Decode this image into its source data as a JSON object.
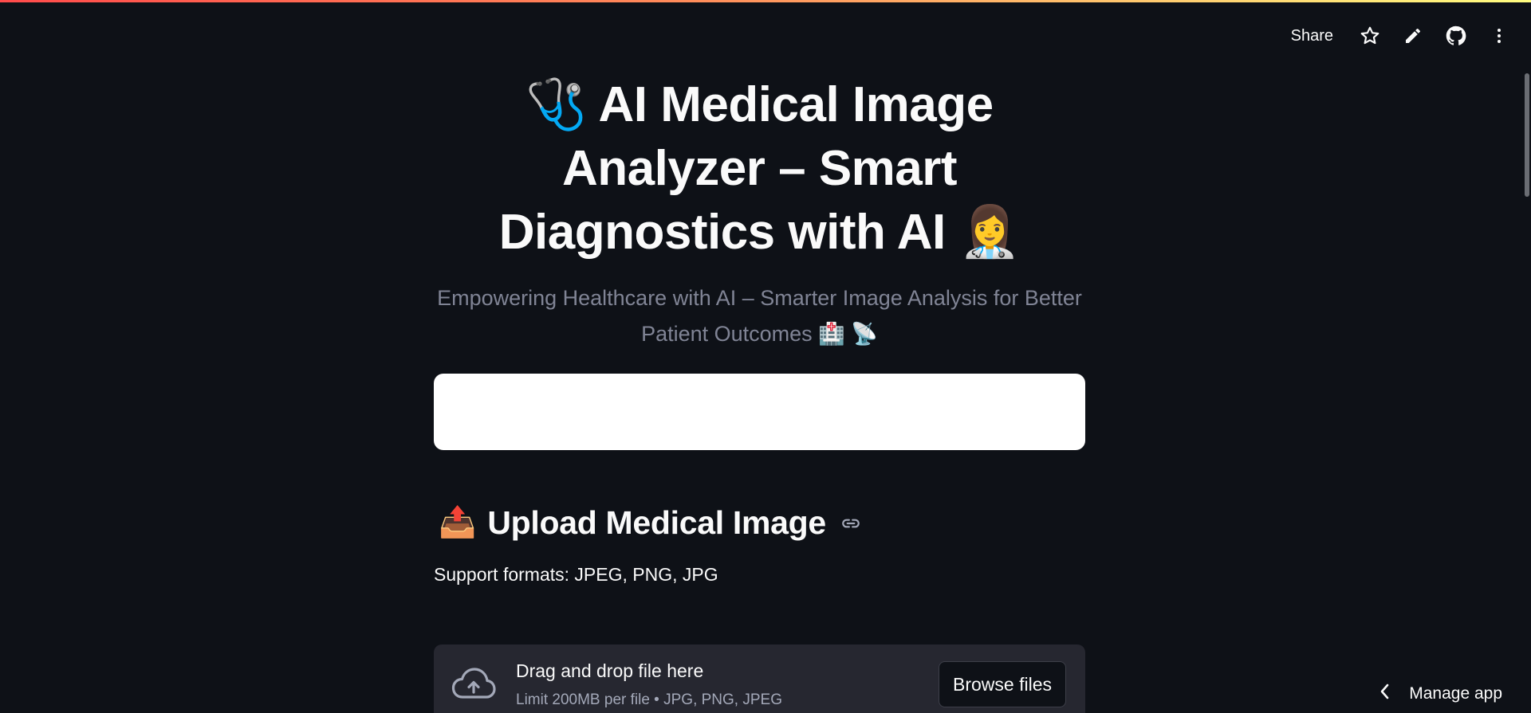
{
  "toolbar": {
    "share_label": "Share",
    "icons": [
      "star-icon",
      "pencil-icon",
      "github-icon",
      "more-vertical-icon"
    ]
  },
  "header": {
    "title_emoji_start": "🩺",
    "title_text": "AI Medical Image Analyzer – Smart Diagnostics with AI",
    "title_emoji_end": "👩‍⚕️",
    "subtitle_text": "Empowering Healthcare with AI – Smarter Image Analysis for Better Patient Outcomes",
    "subtitle_emojis": "🏥 📡"
  },
  "upload_section": {
    "emoji": "📤",
    "heading": "Upload Medical Image",
    "formats_text": "Support formats: JPEG, PNG, JPG"
  },
  "uploader": {
    "drag_title": "Drag and drop file here",
    "limit_text": "Limit 200MB per file • JPG, PNG, JPEG",
    "browse_label": "Browse files"
  },
  "footer": {
    "manage_label": "Manage app"
  },
  "colors": {
    "background": "#0e1117",
    "text": "#fafafa",
    "muted": "#808495",
    "uploader_bg": "#262730",
    "stripe_start": "#ff4b4b",
    "stripe_end": "#fffd80"
  }
}
